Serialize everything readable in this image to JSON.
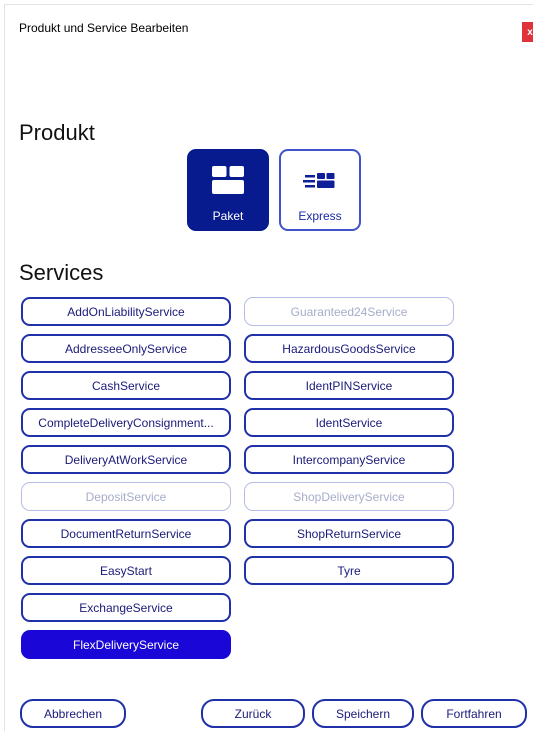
{
  "dialog": {
    "title": "Produkt und Service Bearbeiten",
    "close_label": "x"
  },
  "produkt": {
    "heading": "Produkt",
    "options": [
      {
        "label": "Paket",
        "icon": "package-icon",
        "selected": true
      },
      {
        "label": "Express",
        "icon": "express-icon",
        "selected": false
      }
    ]
  },
  "services": {
    "heading": "Services",
    "left": [
      {
        "label": "AddOnLiabilityService",
        "state": "normal"
      },
      {
        "label": "AddresseeOnlyService",
        "state": "normal"
      },
      {
        "label": "CashService",
        "state": "normal"
      },
      {
        "label": "CompleteDeliveryConsignment...",
        "state": "normal"
      },
      {
        "label": "DeliveryAtWorkService",
        "state": "normal"
      },
      {
        "label": "DepositService",
        "state": "disabled"
      },
      {
        "label": "DocumentReturnService",
        "state": "normal"
      },
      {
        "label": "EasyStart",
        "state": "normal"
      },
      {
        "label": "ExchangeService",
        "state": "normal"
      },
      {
        "label": "FlexDeliveryService",
        "state": "selected"
      }
    ],
    "right": [
      {
        "label": "Guaranteed24Service",
        "state": "disabled"
      },
      {
        "label": "HazardousGoodsService",
        "state": "normal"
      },
      {
        "label": "IdentPINService",
        "state": "normal"
      },
      {
        "label": "IdentService",
        "state": "normal"
      },
      {
        "label": "IntercompanyService",
        "state": "normal"
      },
      {
        "label": "ShopDeliveryService",
        "state": "disabled"
      },
      {
        "label": "ShopReturnService",
        "state": "normal"
      },
      {
        "label": "Tyre",
        "state": "normal"
      }
    ]
  },
  "footer": {
    "cancel": "Abbrechen",
    "back": "Zurück",
    "save": "Speichern",
    "next": "Fortfahren"
  },
  "colors": {
    "accent_dark": "#081b8e",
    "selected_blue": "#1a06d6",
    "border_blue": "#2031a8",
    "close_red": "#e0323a"
  }
}
